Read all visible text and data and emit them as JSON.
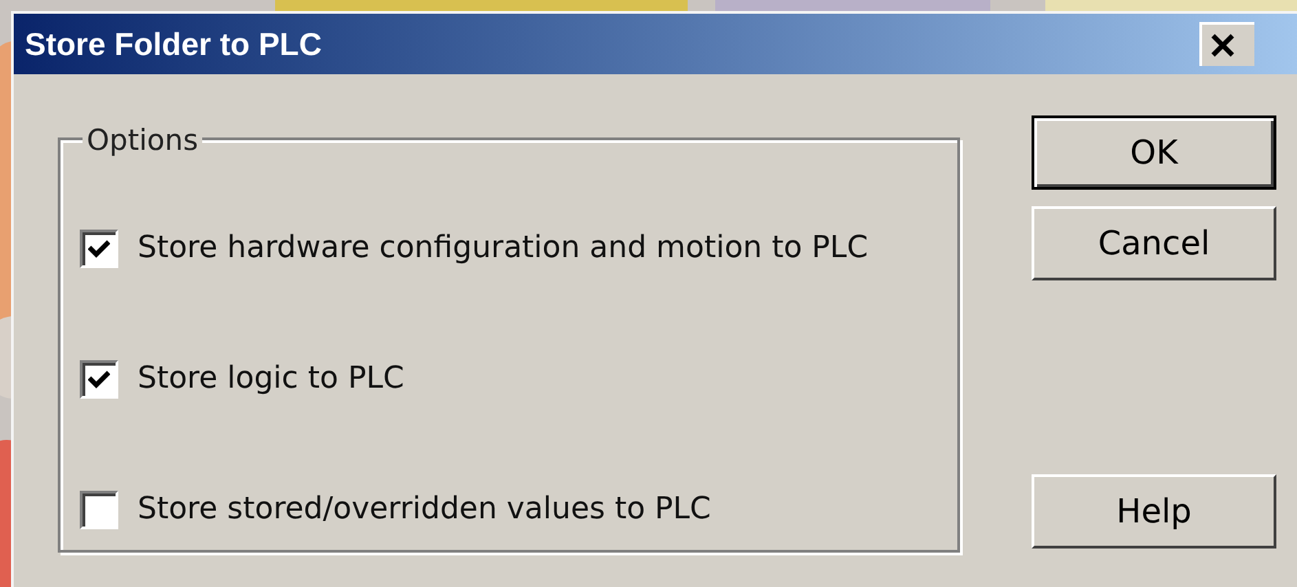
{
  "window": {
    "title": "Store Folder to PLC"
  },
  "options": {
    "label": "Options",
    "items": [
      {
        "label": "Store hardware configuration and motion to PLC",
        "checked": true
      },
      {
        "label": "Store logic to PLC",
        "checked": true
      },
      {
        "label": "Store stored/overridden values to PLC",
        "checked": false
      }
    ]
  },
  "buttons": [
    {
      "label": "OK",
      "default": true
    },
    {
      "label": "Cancel",
      "default": false
    },
    {
      "label": "Help",
      "default": false
    }
  ]
}
